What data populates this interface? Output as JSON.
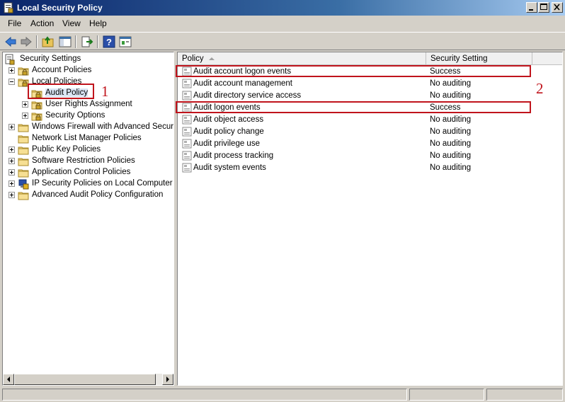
{
  "window": {
    "title": "Local Security Policy"
  },
  "menu": [
    "File",
    "Action",
    "View",
    "Help"
  ],
  "toolbar": {
    "buttons": [
      "back-icon",
      "forward-icon",
      "up-folder-icon",
      "show-hide-tree-icon",
      "export-list-icon",
      "help-icon",
      "properties-icon"
    ]
  },
  "tree": {
    "root": "Security Settings",
    "items": [
      {
        "label": "Account Policies",
        "icon": "lock-folder-icon",
        "expander": "plus"
      },
      {
        "label": "Local Policies",
        "icon": "lock-folder-icon",
        "expander": "minus"
      },
      {
        "label": "Audit Policy",
        "icon": "lock-folder-icon",
        "expander": "none",
        "selected": true
      },
      {
        "label": "User Rights Assignment",
        "icon": "lock-folder-icon",
        "expander": "plus"
      },
      {
        "label": "Security Options",
        "icon": "lock-folder-icon",
        "expander": "plus"
      },
      {
        "label": "Windows Firewall with Advanced Security",
        "icon": "folder-icon",
        "expander": "plus"
      },
      {
        "label": "Network List Manager Policies",
        "icon": "folder-icon",
        "expander": "none"
      },
      {
        "label": "Public Key Policies",
        "icon": "folder-icon",
        "expander": "plus"
      },
      {
        "label": "Software Restriction Policies",
        "icon": "folder-icon",
        "expander": "plus"
      },
      {
        "label": "Application Control Policies",
        "icon": "folder-icon",
        "expander": "plus"
      },
      {
        "label": "IP Security Policies on Local Computer",
        "icon": "ip-security-icon",
        "expander": "plus"
      },
      {
        "label": "Advanced Audit Policy Configuration",
        "icon": "folder-icon",
        "expander": "plus"
      }
    ]
  },
  "list": {
    "columns": [
      "Policy",
      "Security Setting"
    ],
    "rows": [
      {
        "policy": "Audit account logon events",
        "setting": "Success"
      },
      {
        "policy": "Audit account management",
        "setting": "No auditing"
      },
      {
        "policy": "Audit directory service access",
        "setting": "No auditing"
      },
      {
        "policy": "Audit logon events",
        "setting": "Success"
      },
      {
        "policy": "Audit object access",
        "setting": "No auditing"
      },
      {
        "policy": "Audit policy change",
        "setting": "No auditing"
      },
      {
        "policy": "Audit privilege use",
        "setting": "No auditing"
      },
      {
        "policy": "Audit process tracking",
        "setting": "No auditing"
      },
      {
        "policy": "Audit system events",
        "setting": "No auditing"
      }
    ]
  },
  "annotations": {
    "label_1": "1",
    "label_2": "2",
    "color": "#c0141c"
  },
  "colors": {
    "titlebar": "#0a246a",
    "chrome": "#d4d0c8"
  }
}
